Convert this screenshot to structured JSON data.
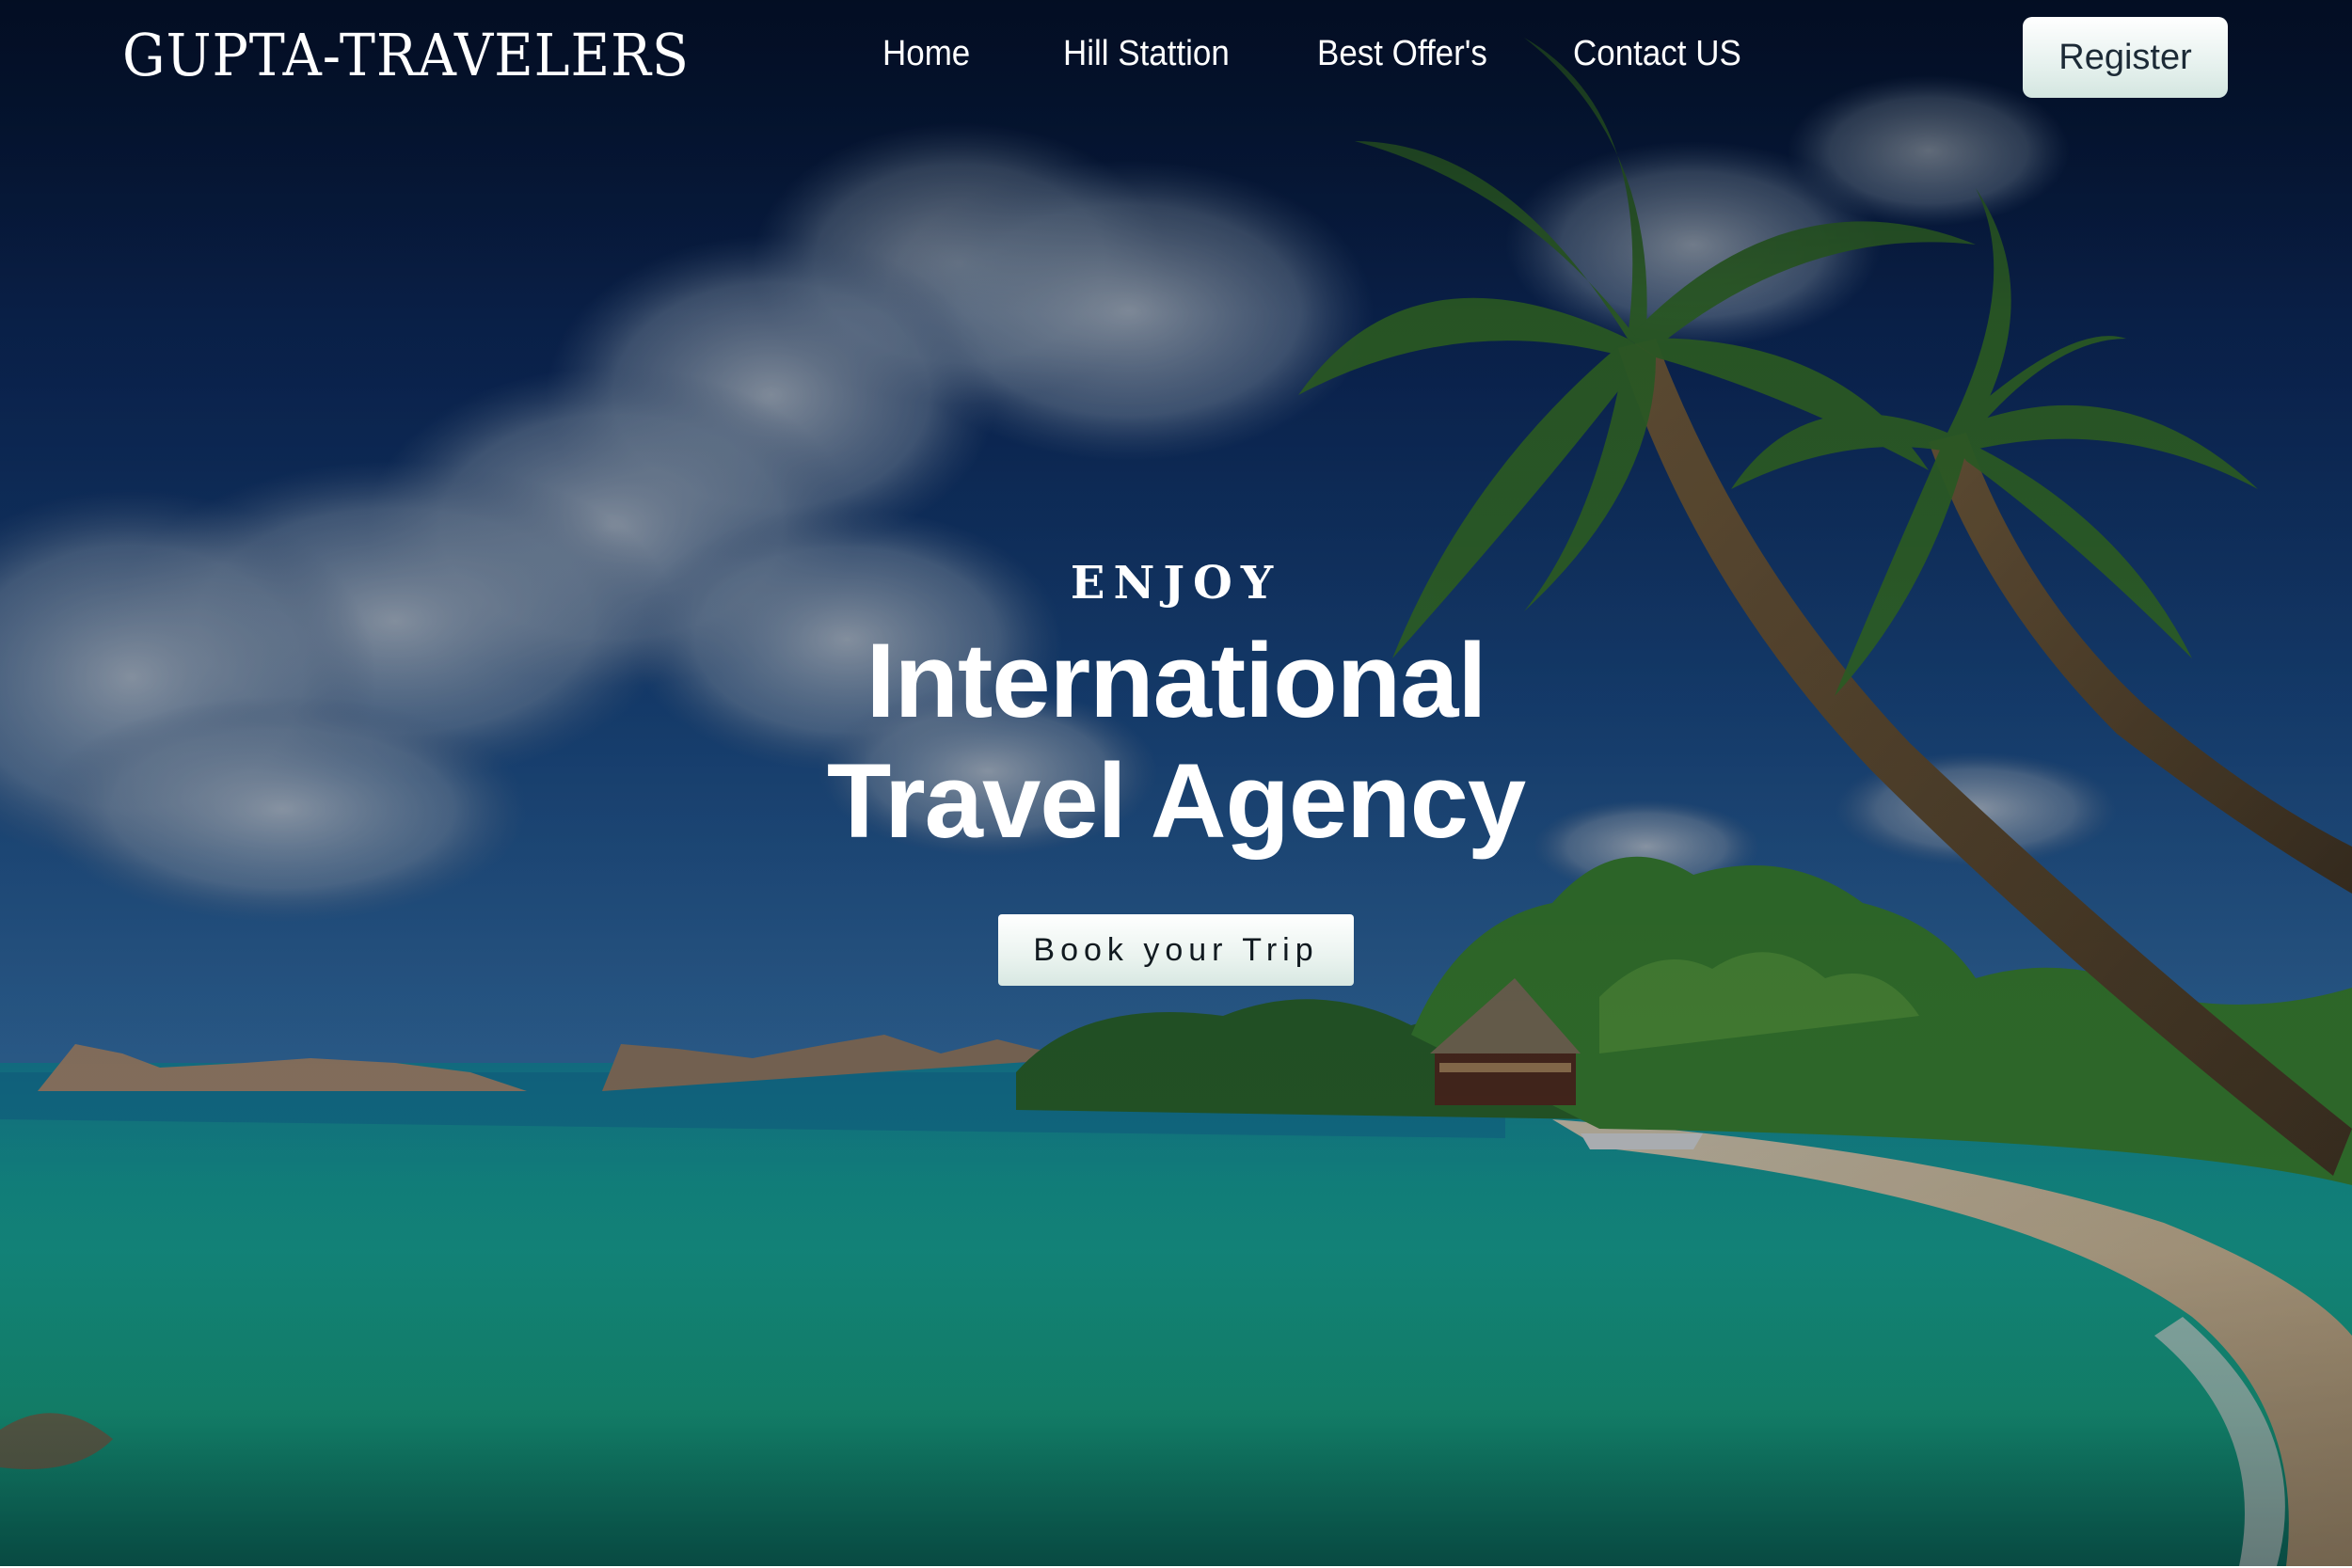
{
  "brand": {
    "name": "GUPTA-TRAVELERS"
  },
  "nav": {
    "items": [
      {
        "label": "Home"
      },
      {
        "label": "Hill Stattion"
      },
      {
        "label": "Best Offer's"
      },
      {
        "label": "Contact US"
      }
    ],
    "register_label": "Register"
  },
  "hero": {
    "eyebrow": "ENJOY",
    "headline": "International Travel Agency",
    "cta_label": "Book your Trip",
    "background": "tropical-beach-photo"
  },
  "colors": {
    "sky_dark": "#0b1f45",
    "sea": "#18b39a",
    "sand": "#e8d4ad",
    "button_bg": "#eef6f3",
    "text": "#ffffff"
  }
}
